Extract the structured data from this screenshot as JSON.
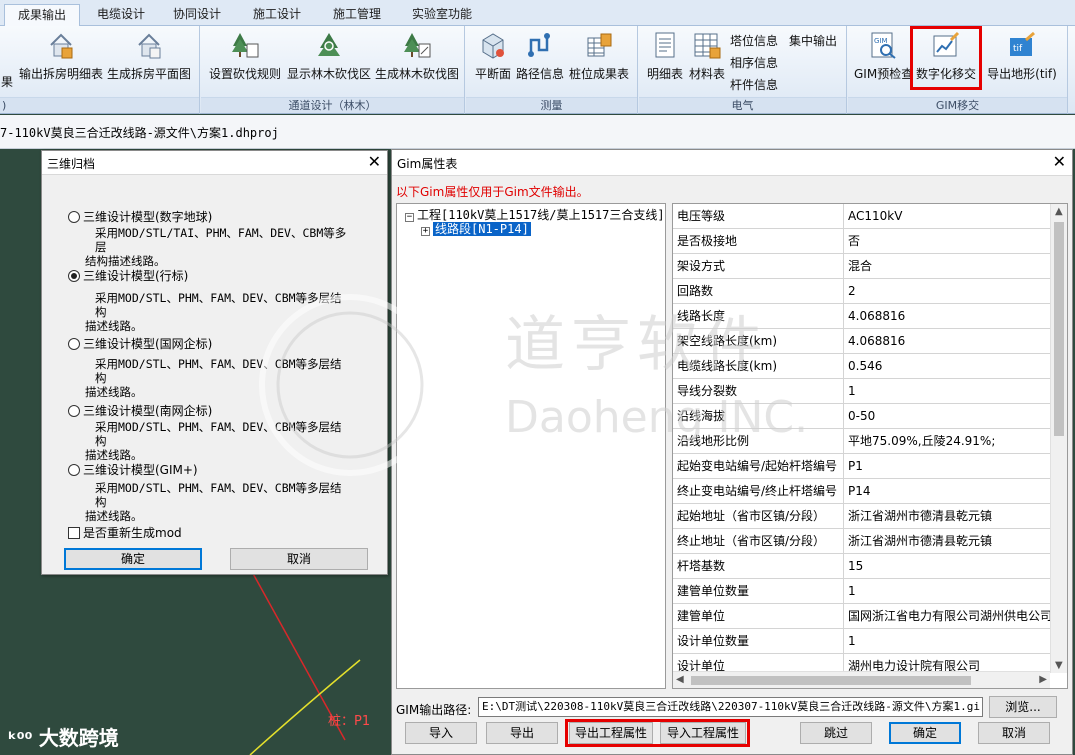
{
  "tabs": [
    "成果输出",
    "电缆设计",
    "协同设计",
    "施工设计",
    "施工管理",
    "实验室功能"
  ],
  "ribbon": {
    "group1": {
      "btn_a": "果",
      "btn_b": "输出拆房明细表",
      "btn_c": "生成拆房平面图",
      "label": ")"
    },
    "group2": {
      "btn_a": "设置砍伐规则",
      "btn_b": "显示林木砍伐区",
      "btn_c": "生成林木砍伐图",
      "label": "通道设计（林木）"
    },
    "group3": {
      "btn_a": "平断面",
      "btn_b": "路径信息",
      "btn_c": "桩位成果表",
      "label": "测量"
    },
    "group4": {
      "btn_a": "明细表",
      "btn_b": "材料表",
      "small_a": "塔位信息",
      "small_b": "集中输出",
      "small_c": "相序信息",
      "small_d": "杆件信息",
      "label": "电气"
    },
    "group5": {
      "btn_a": "GIM预检查",
      "btn_b": "数字化移交",
      "btn_c": "导出地形(tif)",
      "label": "GIM移交"
    }
  },
  "file_path": "7-110kV莫良三合迁改线路-源文件\\方案1.dhproj",
  "dialog_archive": {
    "title": "三维归档",
    "options": [
      {
        "label": "三维设计模型(数字地球)",
        "desc_line1": "采用MOD/STL/TAI、PHM、FAM、DEV、CBM等多层",
        "desc_line2": "结构描述线路。"
      },
      {
        "label": "三维设计模型(行标)",
        "desc_line1": "采用MOD/STL、PHM、FAM、DEV、CBM等多层结构",
        "desc_line2": "描述线路。"
      },
      {
        "label": "三维设计模型(国网企标)",
        "desc_line1": "采用MOD/STL、PHM、FAM、DEV、CBM等多层结构",
        "desc_line2": "描述线路。"
      },
      {
        "label": "三维设计模型(南网企标)",
        "desc_line1": "采用MOD/STL、PHM、FAM、DEV、CBM等多层结构",
        "desc_line2": "描述线路。"
      },
      {
        "label": "三维设计模型(GIM+)",
        "desc_line1": "采用MOD/STL、PHM、FAM、DEV、CBM等多层结构",
        "desc_line2": "描述线路。"
      }
    ],
    "selected_index": 1,
    "regen_checkbox": "是否重新生成mod",
    "ok": "确定",
    "cancel": "取消"
  },
  "dialog_gim": {
    "title": "Gim属性表",
    "note": "以下Gim属性仅用于Gim文件输出。",
    "tree_root": "工程[110kV莫上1517线/莫上1517三合支线]",
    "tree_child": "线路段[N1-P14]",
    "properties": [
      {
        "k": "电压等级",
        "v": "AC110kV"
      },
      {
        "k": "是否极接地",
        "v": "否"
      },
      {
        "k": "架设方式",
        "v": "混合"
      },
      {
        "k": "回路数",
        "v": "2"
      },
      {
        "k": "线路长度",
        "v": "4.068816"
      },
      {
        "k": "架空线路长度(km)",
        "v": "4.068816"
      },
      {
        "k": "电缆线路长度(km)",
        "v": "0.546"
      },
      {
        "k": "导线分裂数",
        "v": "1"
      },
      {
        "k": "沿线海拔",
        "v": "0-50"
      },
      {
        "k": "沿线地形比例",
        "v": "平地75.09%,丘陵24.91%;"
      },
      {
        "k": "起始变电站编号/起始杆塔编号",
        "v": "P1"
      },
      {
        "k": "终止变电站编号/终止杆塔编号",
        "v": "P14"
      },
      {
        "k": "起始地址（省市区镇/分段）",
        "v": "浙江省湖州市德清县乾元镇"
      },
      {
        "k": "终止地址（省市区镇/分段）",
        "v": "浙江省湖州市德清县乾元镇"
      },
      {
        "k": "杆塔基数",
        "v": "15"
      },
      {
        "k": "建管单位数量",
        "v": "1"
      },
      {
        "k": "建管单位",
        "v": "国网浙江省电力有限公司湖州供电公司"
      },
      {
        "k": "设计单位数量",
        "v": "1"
      },
      {
        "k": "设计单位",
        "v": "湖州电力设计院有限公司"
      }
    ],
    "path_label": "GIM输出路径:",
    "path_value": "E:\\DT测试\\220308-110kV莫良三合迁改线路\\220307-110kV莫良三合迁改线路-源文件\\方案1.gi",
    "browse": "浏览...",
    "btn_import": "导入",
    "btn_export": "导出",
    "btn_export_prop": "导出工程属性",
    "btn_import_prop": "导入工程属性",
    "btn_skip": "跳过",
    "btn_ok": "确定",
    "btn_cancel": "取消"
  },
  "scene": {
    "pile_label": "桩：P1"
  },
  "watermarks": {
    "brand_cn": "道亨软件",
    "brand_en": "Daoheng INC.",
    "bottom_logo": "大数跨境"
  },
  "colors": {
    "highlight_red": "#e60000",
    "selection_blue": "#0a64c8",
    "note_red": "#e00000"
  }
}
